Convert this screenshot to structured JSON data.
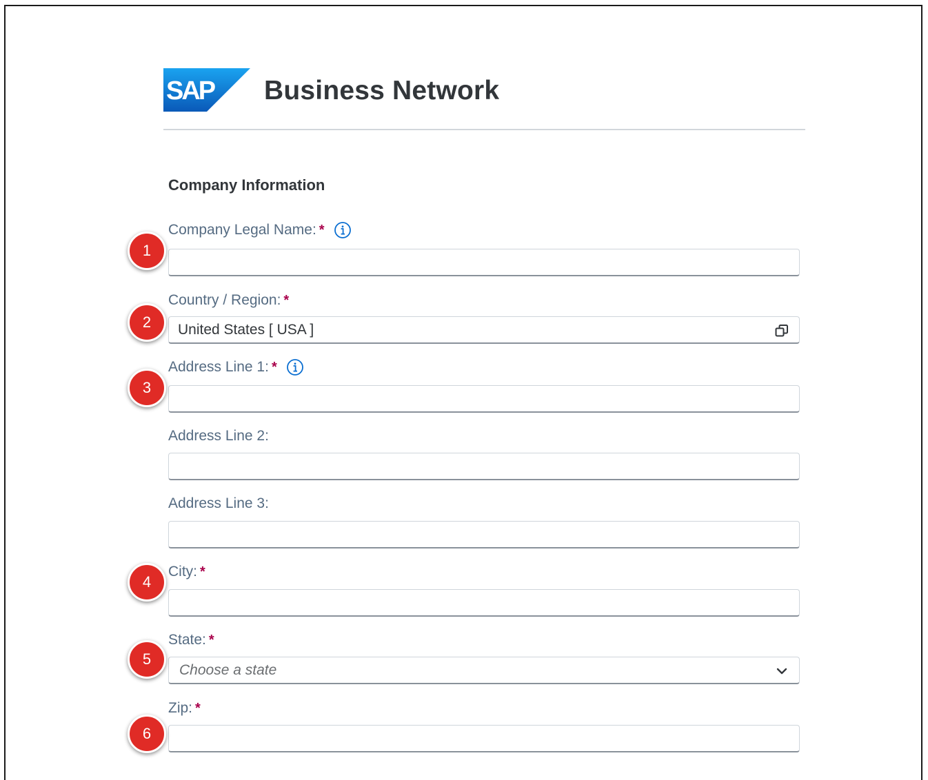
{
  "brand": {
    "logo_text": "SAP",
    "title": "Business Network"
  },
  "form": {
    "section_title": "Company Information",
    "required_marker": "*",
    "fields": {
      "company_legal_name": {
        "label": "Company Legal Name:",
        "value": "",
        "has_info": true
      },
      "country_region": {
        "label": "Country / Region:",
        "value": "United States [ USA ]"
      },
      "address_line_1": {
        "label": "Address Line 1:",
        "value": "",
        "has_info": true
      },
      "address_line_2": {
        "label": "Address Line 2:",
        "value": ""
      },
      "address_line_3": {
        "label": "Address Line 3:",
        "value": ""
      },
      "city": {
        "label": "City:",
        "value": ""
      },
      "state": {
        "label": "State:",
        "placeholder": "Choose a state"
      },
      "zip": {
        "label": "Zip:",
        "value": ""
      }
    }
  },
  "callouts": [
    "1",
    "2",
    "3",
    "4",
    "5",
    "6"
  ],
  "colors": {
    "callout_red": "#e02b26",
    "required_star": "#a9004b",
    "info_icon_blue": "#0a6ed1",
    "label_gray": "#556b82",
    "heading_dark": "#32363a",
    "sap_logo_blue": "#0070f2"
  },
  "icons": {
    "info": "info-icon",
    "value_help": "value-help-icon",
    "dropdown": "chevron-down-icon"
  }
}
